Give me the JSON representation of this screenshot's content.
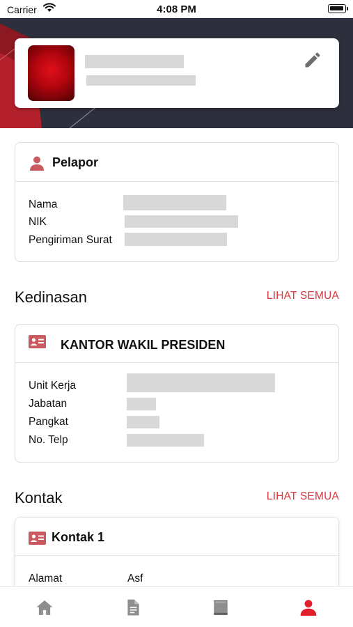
{
  "status_bar": {
    "carrier": "Carrier",
    "time": "4:08 PM"
  },
  "profile": {
    "name_redacted": true,
    "subtitle_redacted": true,
    "edit_icon": "pencil-icon"
  },
  "pelapor": {
    "title": "Pelapor",
    "icon": "person-icon",
    "rows": [
      {
        "label": "Nama",
        "value": ""
      },
      {
        "label": "NIK",
        "value": ""
      },
      {
        "label": "Pengiriman Surat",
        "value": ""
      }
    ]
  },
  "kedinasan": {
    "section_title": "Kedinasan",
    "see_all": "LIHAT SEMUA",
    "card": {
      "title": "KANTOR WAKIL PRESIDEN",
      "icon": "id-card-icon",
      "rows": [
        {
          "label": "Unit Kerja",
          "value": ""
        },
        {
          "label": "Jabatan",
          "value": ""
        },
        {
          "label": "Pangkat",
          "value": ""
        },
        {
          "label": "No. Telp",
          "value": ""
        }
      ]
    }
  },
  "kontak": {
    "section_title": "Kontak",
    "see_all": "LIHAT SEMUA",
    "card": {
      "title": "Kontak 1",
      "icon": "id-card-icon",
      "rows": [
        {
          "label": "Alamat",
          "value": "Asf"
        }
      ]
    }
  },
  "bottom_nav": {
    "items": [
      "home-icon",
      "document-icon",
      "book-icon",
      "person-icon"
    ],
    "active_index": 3
  },
  "colors": {
    "accent": "#d9363e",
    "banner": "#2e2f3d",
    "icon_inactive": "#8e8e8e"
  }
}
